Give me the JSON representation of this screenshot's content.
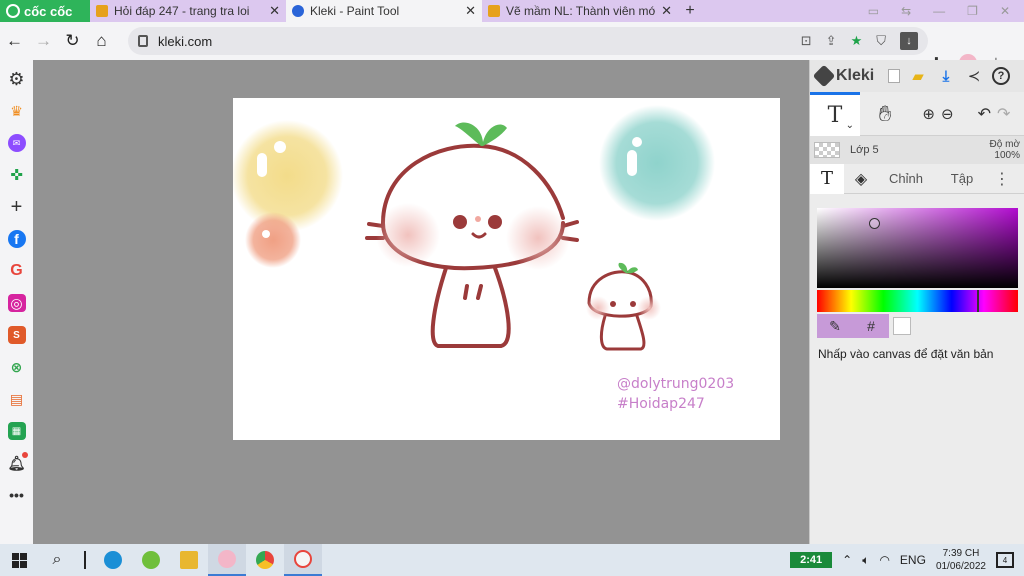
{
  "browser": {
    "brand": "cốc cốc",
    "tabs": [
      {
        "label": "Hỏi đáp 247 - trang tra loi",
        "active": false
      },
      {
        "label": "Kleki - Paint Tool",
        "active": true
      },
      {
        "label": "Vẽ mầm NL: Thành viên mới",
        "active": false
      }
    ],
    "new_tab": "+",
    "url": "kleki.com"
  },
  "kleki": {
    "logo": "Kleki",
    "layer_name": "Lớp 5",
    "opacity_label": "Độ mờ",
    "opacity_value": "100%",
    "tabs": {
      "edit": "Chỉnh",
      "file": "Tập"
    },
    "color_hex_label": "#",
    "hint": "Nhấp vào canvas để đặt văn bản",
    "colors": {
      "accent": "#1a73e8",
      "picker_hue": "#b10ccf",
      "color_row_bg": "#c79ad8",
      "swatch": "#ffffff"
    }
  },
  "canvas": {
    "watermark_line1": "@dolytrung0203",
    "watermark_line2": "#Hoidap247",
    "colors": {
      "outline": "#9b3a3a",
      "sprout": "#5dbb5a",
      "yellow_blob": "#f3dc8a",
      "teal_blob": "#8fd3cc",
      "orange_blob": "#f0a084",
      "blush": "#f1c2be",
      "watermark": "#c77fc9"
    }
  },
  "taskbar": {
    "battery": "2:41",
    "language": "ENG",
    "time": "7:39 CH",
    "date": "01/06/2022",
    "notification_count": "4"
  }
}
